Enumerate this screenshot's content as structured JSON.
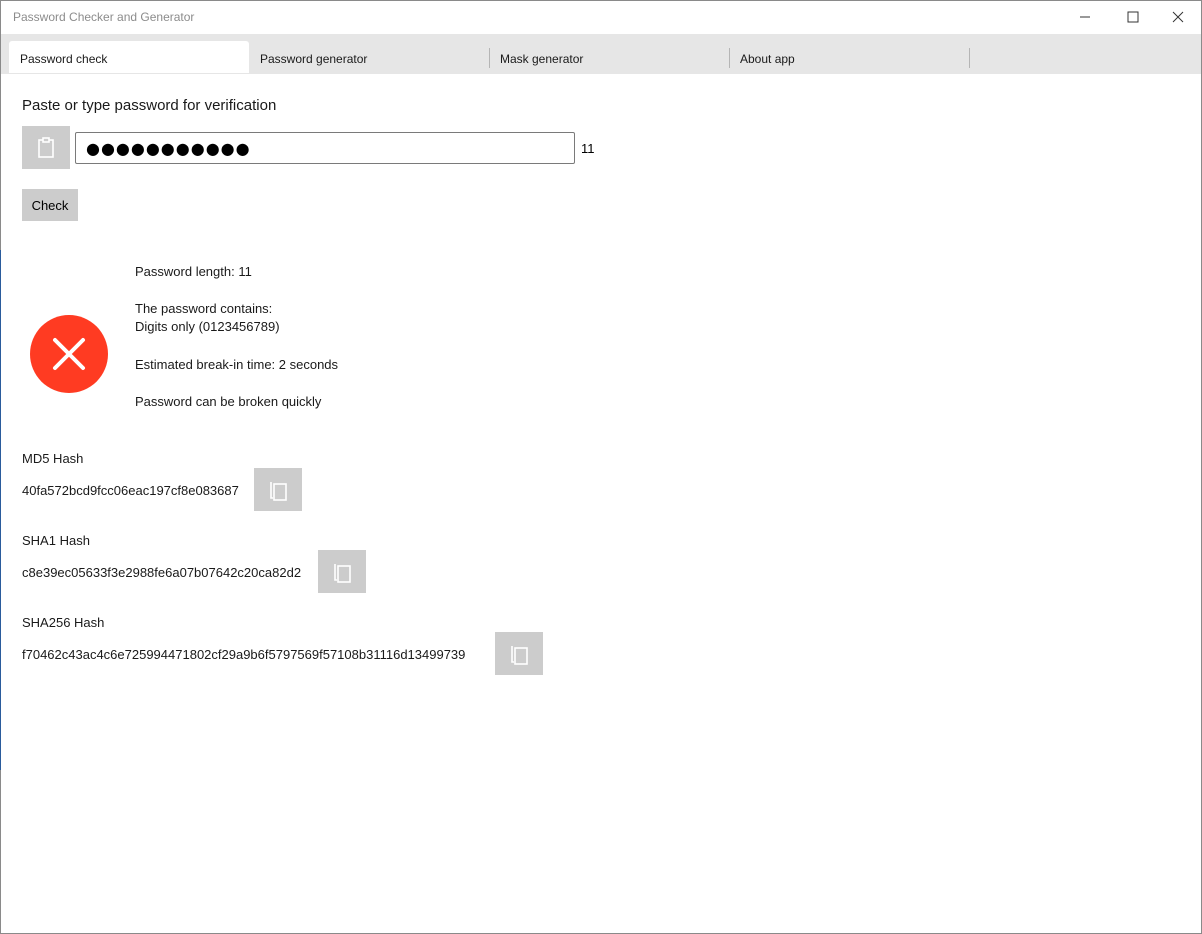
{
  "window": {
    "title": "Password Checker and Generator",
    "controls": [
      "minimize-icon",
      "maximize-icon",
      "close-icon"
    ]
  },
  "tabs": [
    {
      "label": "Password check",
      "active": true
    },
    {
      "label": "Password generator",
      "active": false
    },
    {
      "label": "Mask generator",
      "active": false
    },
    {
      "label": "About app",
      "active": false
    }
  ],
  "check": {
    "prompt": "Paste or type password for verification",
    "paste_icon": "clipboard-icon",
    "password_masked": "●●●●●●●●●●●",
    "length_counter": "11",
    "check_label": "Check"
  },
  "result": {
    "status_icon": "error-x-icon",
    "status_color": "#ff3b22",
    "length_line": "Password length: 11",
    "contains_heading": "The password contains:",
    "contains_value": "Digits only (0123456789)",
    "break_time": "Estimated break-in time: 2 seconds",
    "verdict": "Password can be broken quickly"
  },
  "hashes": {
    "md5": {
      "label": "MD5 Hash",
      "value": "40fa572bcd9fcc06eac197cf8e083687",
      "copy_icon": "copy-icon"
    },
    "sha1": {
      "label": "SHA1 Hash",
      "value": "c8e39ec05633f3e2988fe6a07b07642c20ca82d2",
      "copy_icon": "copy-icon"
    },
    "sha256": {
      "label": "SHA256 Hash",
      "value": "f70462c43ac4c6e725994471802cf29a9b6f5797569f57108b31116d13499739",
      "copy_icon": "copy-icon"
    }
  },
  "colors": {
    "button_gray": "#cccccc",
    "tab_bar": "#e6e6e6",
    "error_red": "#ff3b22"
  }
}
